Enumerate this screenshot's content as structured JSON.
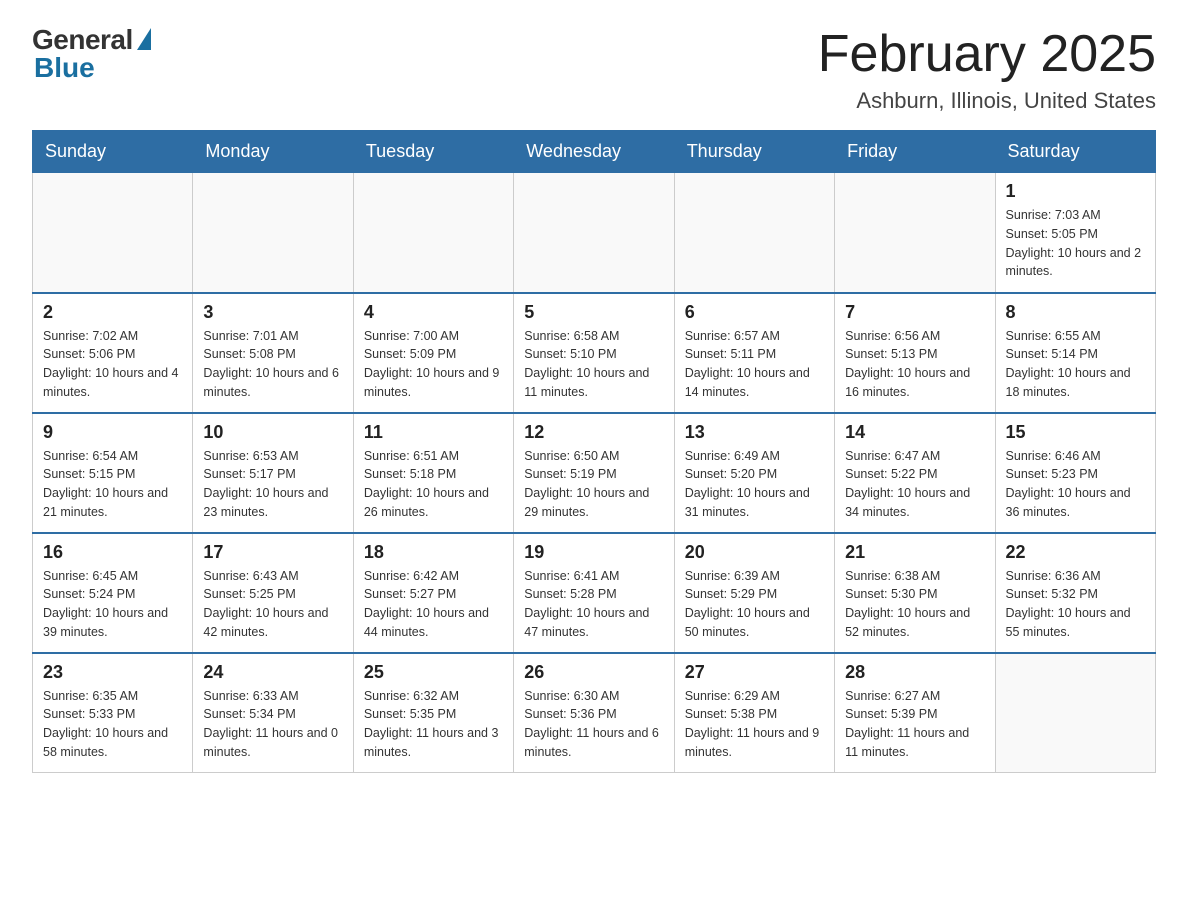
{
  "logo": {
    "general": "General",
    "blue": "Blue"
  },
  "header": {
    "month_year": "February 2025",
    "location": "Ashburn, Illinois, United States"
  },
  "weekdays": [
    "Sunday",
    "Monday",
    "Tuesday",
    "Wednesday",
    "Thursday",
    "Friday",
    "Saturday"
  ],
  "weeks": [
    [
      {
        "day": "",
        "sunrise": "",
        "sunset": "",
        "daylight": ""
      },
      {
        "day": "",
        "sunrise": "",
        "sunset": "",
        "daylight": ""
      },
      {
        "day": "",
        "sunrise": "",
        "sunset": "",
        "daylight": ""
      },
      {
        "day": "",
        "sunrise": "",
        "sunset": "",
        "daylight": ""
      },
      {
        "day": "",
        "sunrise": "",
        "sunset": "",
        "daylight": ""
      },
      {
        "day": "",
        "sunrise": "",
        "sunset": "",
        "daylight": ""
      },
      {
        "day": "1",
        "sunrise": "Sunrise: 7:03 AM",
        "sunset": "Sunset: 5:05 PM",
        "daylight": "Daylight: 10 hours and 2 minutes."
      }
    ],
    [
      {
        "day": "2",
        "sunrise": "Sunrise: 7:02 AM",
        "sunset": "Sunset: 5:06 PM",
        "daylight": "Daylight: 10 hours and 4 minutes."
      },
      {
        "day": "3",
        "sunrise": "Sunrise: 7:01 AM",
        "sunset": "Sunset: 5:08 PM",
        "daylight": "Daylight: 10 hours and 6 minutes."
      },
      {
        "day": "4",
        "sunrise": "Sunrise: 7:00 AM",
        "sunset": "Sunset: 5:09 PM",
        "daylight": "Daylight: 10 hours and 9 minutes."
      },
      {
        "day": "5",
        "sunrise": "Sunrise: 6:58 AM",
        "sunset": "Sunset: 5:10 PM",
        "daylight": "Daylight: 10 hours and 11 minutes."
      },
      {
        "day": "6",
        "sunrise": "Sunrise: 6:57 AM",
        "sunset": "Sunset: 5:11 PM",
        "daylight": "Daylight: 10 hours and 14 minutes."
      },
      {
        "day": "7",
        "sunrise": "Sunrise: 6:56 AM",
        "sunset": "Sunset: 5:13 PM",
        "daylight": "Daylight: 10 hours and 16 minutes."
      },
      {
        "day": "8",
        "sunrise": "Sunrise: 6:55 AM",
        "sunset": "Sunset: 5:14 PM",
        "daylight": "Daylight: 10 hours and 18 minutes."
      }
    ],
    [
      {
        "day": "9",
        "sunrise": "Sunrise: 6:54 AM",
        "sunset": "Sunset: 5:15 PM",
        "daylight": "Daylight: 10 hours and 21 minutes."
      },
      {
        "day": "10",
        "sunrise": "Sunrise: 6:53 AM",
        "sunset": "Sunset: 5:17 PM",
        "daylight": "Daylight: 10 hours and 23 minutes."
      },
      {
        "day": "11",
        "sunrise": "Sunrise: 6:51 AM",
        "sunset": "Sunset: 5:18 PM",
        "daylight": "Daylight: 10 hours and 26 minutes."
      },
      {
        "day": "12",
        "sunrise": "Sunrise: 6:50 AM",
        "sunset": "Sunset: 5:19 PM",
        "daylight": "Daylight: 10 hours and 29 minutes."
      },
      {
        "day": "13",
        "sunrise": "Sunrise: 6:49 AM",
        "sunset": "Sunset: 5:20 PM",
        "daylight": "Daylight: 10 hours and 31 minutes."
      },
      {
        "day": "14",
        "sunrise": "Sunrise: 6:47 AM",
        "sunset": "Sunset: 5:22 PM",
        "daylight": "Daylight: 10 hours and 34 minutes."
      },
      {
        "day": "15",
        "sunrise": "Sunrise: 6:46 AM",
        "sunset": "Sunset: 5:23 PM",
        "daylight": "Daylight: 10 hours and 36 minutes."
      }
    ],
    [
      {
        "day": "16",
        "sunrise": "Sunrise: 6:45 AM",
        "sunset": "Sunset: 5:24 PM",
        "daylight": "Daylight: 10 hours and 39 minutes."
      },
      {
        "day": "17",
        "sunrise": "Sunrise: 6:43 AM",
        "sunset": "Sunset: 5:25 PM",
        "daylight": "Daylight: 10 hours and 42 minutes."
      },
      {
        "day": "18",
        "sunrise": "Sunrise: 6:42 AM",
        "sunset": "Sunset: 5:27 PM",
        "daylight": "Daylight: 10 hours and 44 minutes."
      },
      {
        "day": "19",
        "sunrise": "Sunrise: 6:41 AM",
        "sunset": "Sunset: 5:28 PM",
        "daylight": "Daylight: 10 hours and 47 minutes."
      },
      {
        "day": "20",
        "sunrise": "Sunrise: 6:39 AM",
        "sunset": "Sunset: 5:29 PM",
        "daylight": "Daylight: 10 hours and 50 minutes."
      },
      {
        "day": "21",
        "sunrise": "Sunrise: 6:38 AM",
        "sunset": "Sunset: 5:30 PM",
        "daylight": "Daylight: 10 hours and 52 minutes."
      },
      {
        "day": "22",
        "sunrise": "Sunrise: 6:36 AM",
        "sunset": "Sunset: 5:32 PM",
        "daylight": "Daylight: 10 hours and 55 minutes."
      }
    ],
    [
      {
        "day": "23",
        "sunrise": "Sunrise: 6:35 AM",
        "sunset": "Sunset: 5:33 PM",
        "daylight": "Daylight: 10 hours and 58 minutes."
      },
      {
        "day": "24",
        "sunrise": "Sunrise: 6:33 AM",
        "sunset": "Sunset: 5:34 PM",
        "daylight": "Daylight: 11 hours and 0 minutes."
      },
      {
        "day": "25",
        "sunrise": "Sunrise: 6:32 AM",
        "sunset": "Sunset: 5:35 PM",
        "daylight": "Daylight: 11 hours and 3 minutes."
      },
      {
        "day": "26",
        "sunrise": "Sunrise: 6:30 AM",
        "sunset": "Sunset: 5:36 PM",
        "daylight": "Daylight: 11 hours and 6 minutes."
      },
      {
        "day": "27",
        "sunrise": "Sunrise: 6:29 AM",
        "sunset": "Sunset: 5:38 PM",
        "daylight": "Daylight: 11 hours and 9 minutes."
      },
      {
        "day": "28",
        "sunrise": "Sunrise: 6:27 AM",
        "sunset": "Sunset: 5:39 PM",
        "daylight": "Daylight: 11 hours and 11 minutes."
      },
      {
        "day": "",
        "sunrise": "",
        "sunset": "",
        "daylight": ""
      }
    ]
  ]
}
